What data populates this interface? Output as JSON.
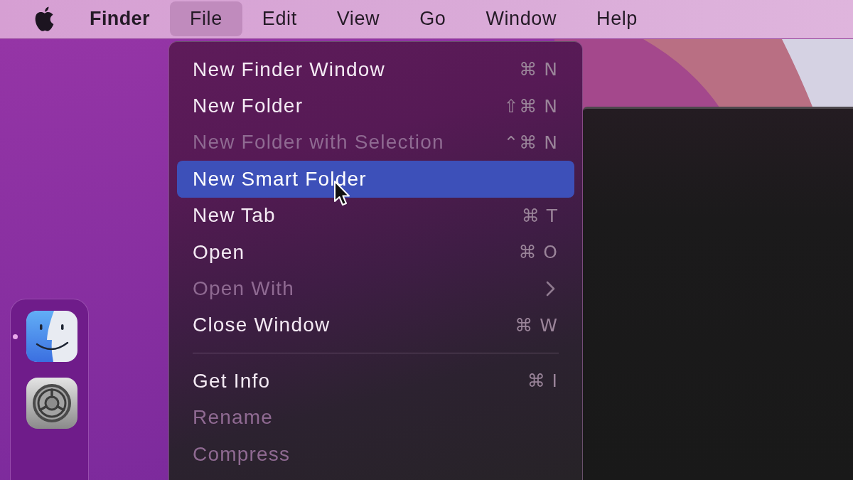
{
  "menu_bar": {
    "items": [
      {
        "label": "Finder",
        "kind": "app",
        "selected": false
      },
      {
        "label": "File",
        "kind": "menu",
        "selected": true
      },
      {
        "label": "Edit",
        "kind": "menu",
        "selected": false
      },
      {
        "label": "View",
        "kind": "menu",
        "selected": false
      },
      {
        "label": "Go",
        "kind": "menu",
        "selected": false
      },
      {
        "label": "Window",
        "kind": "menu",
        "selected": false
      },
      {
        "label": "Help",
        "kind": "menu",
        "selected": false
      }
    ]
  },
  "file_menu": {
    "items": [
      {
        "kind": "item",
        "label": "New Finder Window",
        "shortcut": "⌘ N",
        "disabled": false,
        "selected": false
      },
      {
        "kind": "item",
        "label": "New Folder",
        "shortcut": "⇧⌘ N",
        "disabled": false,
        "selected": false
      },
      {
        "kind": "item",
        "label": "New Folder with Selection",
        "shortcut": "⌃⌘ N",
        "disabled": true,
        "selected": false
      },
      {
        "kind": "item",
        "label": "New Smart Folder",
        "disabled": false,
        "selected": true
      },
      {
        "kind": "item",
        "label": "New Tab",
        "shortcut": "⌘ T",
        "disabled": false,
        "selected": false
      },
      {
        "kind": "item",
        "label": "Open",
        "shortcut": "⌘ O",
        "disabled": false,
        "selected": false
      },
      {
        "kind": "submenu",
        "label": "Open With",
        "disabled": true,
        "selected": false
      },
      {
        "kind": "item",
        "label": "Close Window",
        "shortcut": "⌘ W",
        "disabled": false,
        "selected": false
      },
      {
        "kind": "separator"
      },
      {
        "kind": "item",
        "label": "Get Info",
        "shortcut": "⌘  I",
        "disabled": false,
        "selected": false
      },
      {
        "kind": "item",
        "label": "Rename",
        "disabled": true,
        "selected": false
      },
      {
        "kind": "item",
        "label": "Compress",
        "disabled": true,
        "selected": false
      }
    ]
  },
  "dock": {
    "items": [
      {
        "kind": "finder",
        "running": true
      },
      {
        "kind": "settings",
        "running": false
      }
    ]
  }
}
